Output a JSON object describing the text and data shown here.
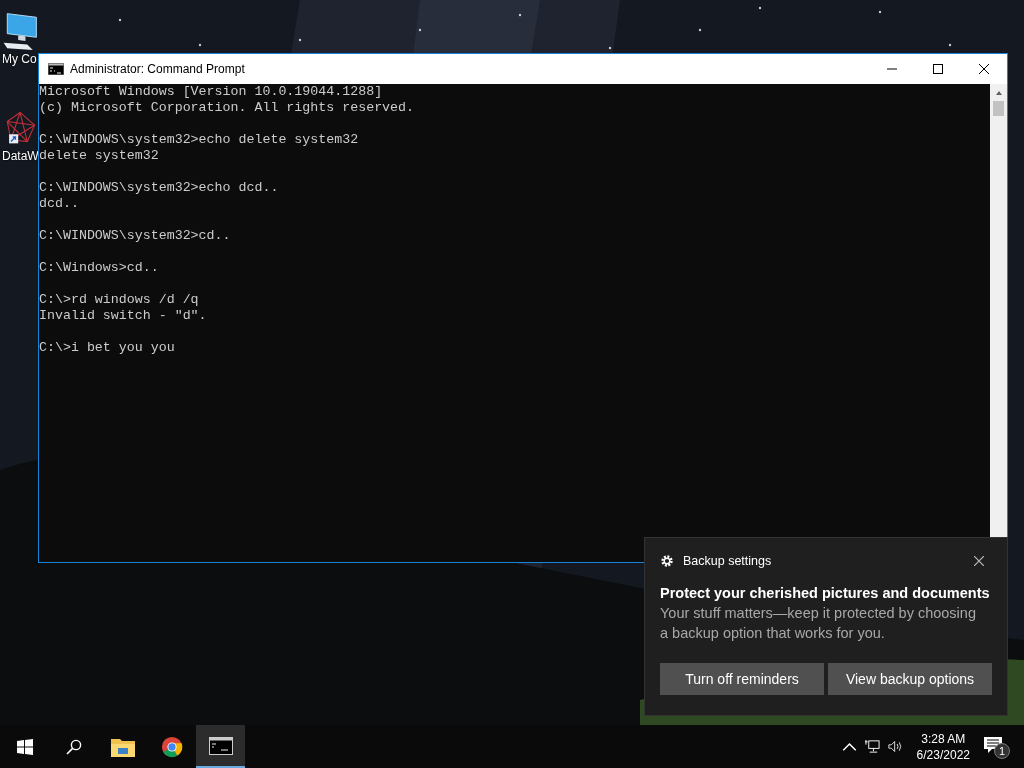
{
  "desktop_icons": [
    {
      "kind": "computer",
      "label": "My Co"
    },
    {
      "kind": "network",
      "label": "DataW"
    }
  ],
  "window": {
    "title": "Administrator: Command Prompt",
    "active": true
  },
  "console": {
    "paragraphs": [
      [
        "Microsoft Windows [Version 10.0.19044.1288]",
        "(c) Microsoft Corporation. All rights reserved."
      ],
      [
        "C:\\WINDOWS\\system32>echo delete system32",
        "delete system32"
      ],
      [
        "C:\\WINDOWS\\system32>echo dcd..",
        "dcd.."
      ],
      [
        "C:\\WINDOWS\\system32>cd.."
      ],
      [
        "C:\\Windows>cd.."
      ],
      [
        "C:\\>rd windows /d /q",
        "Invalid switch - \"d\"."
      ],
      [
        "C:\\>i bet you you"
      ]
    ]
  },
  "toast": {
    "app": "Backup settings",
    "heading": "Protect your cherished pictures and documents",
    "body": "Your stuff matters—keep it protected by choosing a backup option that works for you.",
    "buttons": [
      "Turn off reminders",
      "View backup options"
    ]
  },
  "taskbar": {
    "items": [
      {
        "kind": "start",
        "active": false
      },
      {
        "kind": "search",
        "active": false
      },
      {
        "kind": "explorer",
        "active": false
      },
      {
        "kind": "browser",
        "active": false
      },
      {
        "kind": "terminal",
        "active": true
      }
    ],
    "time": "3:28 AM",
    "date": "6/23/2022",
    "notification_count": "1"
  }
}
